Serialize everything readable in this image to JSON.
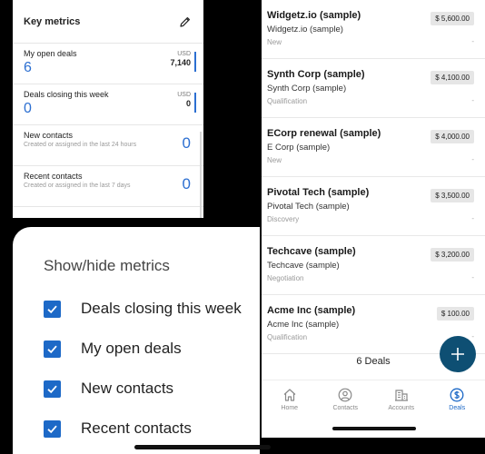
{
  "metrics": {
    "title": "Key metrics",
    "rows": [
      {
        "label": "My open deals",
        "value": "6",
        "currency": "USD",
        "amount": "7,140"
      },
      {
        "label": "Deals closing this week",
        "value": "0",
        "currency": "USD",
        "amount": "0"
      },
      {
        "label": "New contacts",
        "sub": "Created or assigned in the last 24 hours",
        "value": "0"
      },
      {
        "label": "Recent contacts",
        "sub": "Created or assigned in the last 7 days",
        "value": "0"
      }
    ]
  },
  "showhide": {
    "title": "Show/hide metrics",
    "items": [
      {
        "label": "Deals closing this week",
        "checked": true
      },
      {
        "label": "My open deals",
        "checked": true
      },
      {
        "label": "New contacts",
        "checked": true
      },
      {
        "label": "Recent contacts",
        "checked": true
      }
    ]
  },
  "deals": {
    "items": [
      {
        "name": "Widgetz.io (sample)",
        "company": "Widgetz.io (sample)",
        "stage": "New",
        "amount": "$ 5,600.00",
        "extra": "-"
      },
      {
        "name": "Synth Corp (sample)",
        "company": "Synth Corp (sample)",
        "stage": "Qualification",
        "amount": "$ 4,100.00",
        "extra": "-"
      },
      {
        "name": "ECorp renewal (sample)",
        "company": "E Corp (sample)",
        "stage": "New",
        "amount": "$ 4,000.00",
        "extra": "-"
      },
      {
        "name": "Pivotal Tech (sample)",
        "company": "Pivotal Tech (sample)",
        "stage": "Discovery",
        "amount": "$ 3,500.00",
        "extra": "-"
      },
      {
        "name": "Techcave (sample)",
        "company": "Techcave (sample)",
        "stage": "Negotiation",
        "amount": "$ 3,200.00",
        "extra": "-"
      },
      {
        "name": "Acme Inc (sample)",
        "company": "Acme Inc (sample)",
        "stage": "Qualification",
        "amount": "$ 100.00",
        "extra": "-"
      }
    ],
    "count_label": "6 Deals"
  },
  "tabs": {
    "home": "Home",
    "contacts": "Contacts",
    "accounts": "Accounts",
    "deals": "Deals",
    "active": "deals"
  },
  "colors": {
    "accent": "#1d69c7",
    "fab": "#0e4f73",
    "metric_value": "#2c6fd1"
  }
}
